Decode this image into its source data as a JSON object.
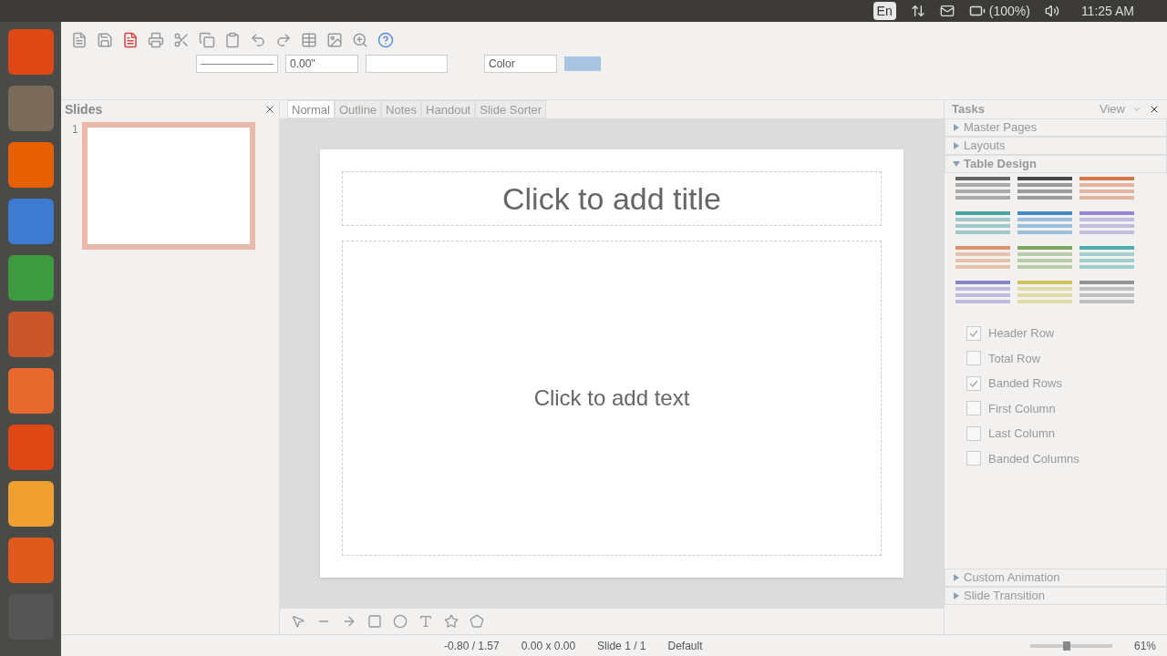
{
  "top_bar": {
    "keyboard": "En",
    "battery": "(100%)",
    "time": "11:25 AM"
  },
  "toolbar": {
    "position_field": "0.00\"",
    "color_field": "Color"
  },
  "slides_panel": {
    "title": "Slides",
    "slides": [
      {
        "number": "1",
        "selected": true
      }
    ]
  },
  "view_tabs": [
    {
      "label": "Normal",
      "selected": true
    },
    {
      "label": "Outline",
      "selected": false
    },
    {
      "label": "Notes",
      "selected": false
    },
    {
      "label": "Handout",
      "selected": false
    },
    {
      "label": "Slide Sorter",
      "selected": false
    }
  ],
  "slide": {
    "title_placeholder": "Click to add title",
    "body_placeholder": "Click to add text"
  },
  "tasks": {
    "title": "Tasks",
    "view": "View",
    "sections": [
      {
        "label": "Master Pages",
        "expanded": false
      },
      {
        "label": "Layouts",
        "expanded": false
      },
      {
        "label": "Table Design",
        "expanded": true
      }
    ],
    "options": [
      {
        "label": "Header Row",
        "checked": true
      },
      {
        "label": "Total Row",
        "checked": false
      },
      {
        "label": "Banded Rows",
        "checked": true
      },
      {
        "label": "First Column",
        "checked": false
      },
      {
        "label": "Last Column",
        "checked": false
      },
      {
        "label": "Banded Columns",
        "checked": false
      }
    ],
    "bottom_sections": [
      {
        "label": "Custom Animation",
        "expanded": false
      },
      {
        "label": "Slide Transition",
        "expanded": false
      }
    ]
  },
  "status_bar": {
    "position": "-0.80 / 1.57",
    "size": "0.00 x 0.00",
    "slide": "Slide 1 / 1",
    "master": "Default",
    "zoom": "61%",
    "zoom_level": {
      "level": 0.45
    }
  }
}
